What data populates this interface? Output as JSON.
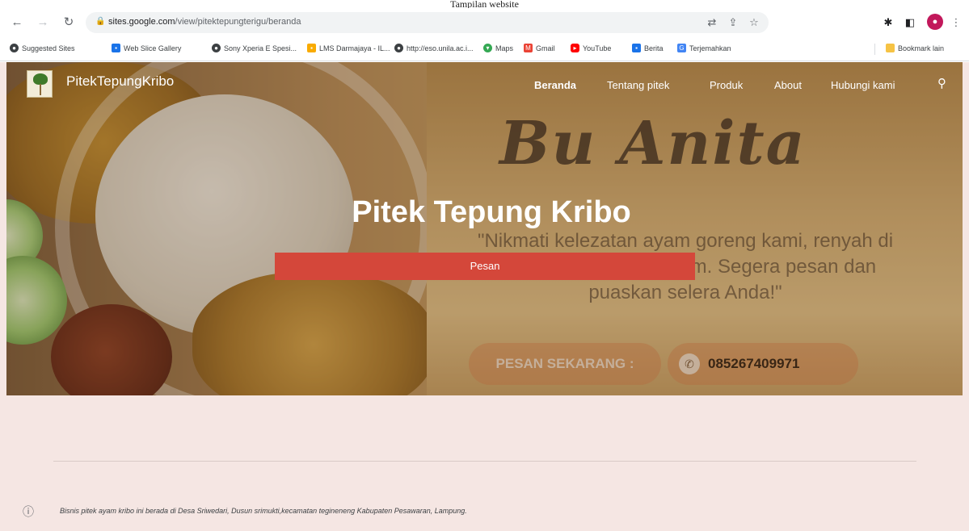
{
  "caption": "Tampilan website",
  "browser": {
    "url_host": "sites.google.com",
    "url_path": "/view/pitektepungterigu/beranda",
    "bookmarks": [
      {
        "label": "Suggested Sites",
        "color": "#3c4043"
      },
      {
        "label": "Web Slice Gallery",
        "color": "#1a73e8"
      },
      {
        "label": "Sony Xperia E Spesi...",
        "color": "#3c4043"
      },
      {
        "label": "LMS Darmajaya - IL...",
        "color": "#f9ab00"
      },
      {
        "label": "http://eso.unila.ac.i...",
        "color": "#3c4043"
      },
      {
        "label": "Maps",
        "color": "#34a853"
      },
      {
        "label": "Gmail",
        "color": "#ea4335"
      },
      {
        "label": "YouTube",
        "color": "#ff0000"
      },
      {
        "label": "Berita",
        "color": "#1a73e8"
      },
      {
        "label": "Terjemahkan",
        "color": "#4285f4"
      }
    ],
    "bookmark_other": "Bookmark lain"
  },
  "site": {
    "name": "PitekTepungKribo",
    "nav": [
      "Beranda",
      "Tentang pitek",
      "Produk",
      "About",
      "Hubungi kami"
    ],
    "active_nav": "Beranda"
  },
  "hero": {
    "title": "Pitek Tepung Kribo",
    "button": "Pesan",
    "banner_script": "Bu Anita",
    "quote": "\"Nikmati kelezatan ayam goreng kami, renyah di luar dan lembut di dalam. Segera pesan dan puaskan selera Anda!\"",
    "order_now": "PESAN SEKARANG :",
    "phone": "085267409971"
  },
  "footer": {
    "text": "Bisnis pitek ayam kribo ini berada di Desa Sriwedari, Dusun srimukti,kecamatan tegineneng Kabupaten Pesawaran, Lampung."
  },
  "colors": {
    "cta": "#d4473a",
    "page_bg": "#f5e6e3"
  }
}
